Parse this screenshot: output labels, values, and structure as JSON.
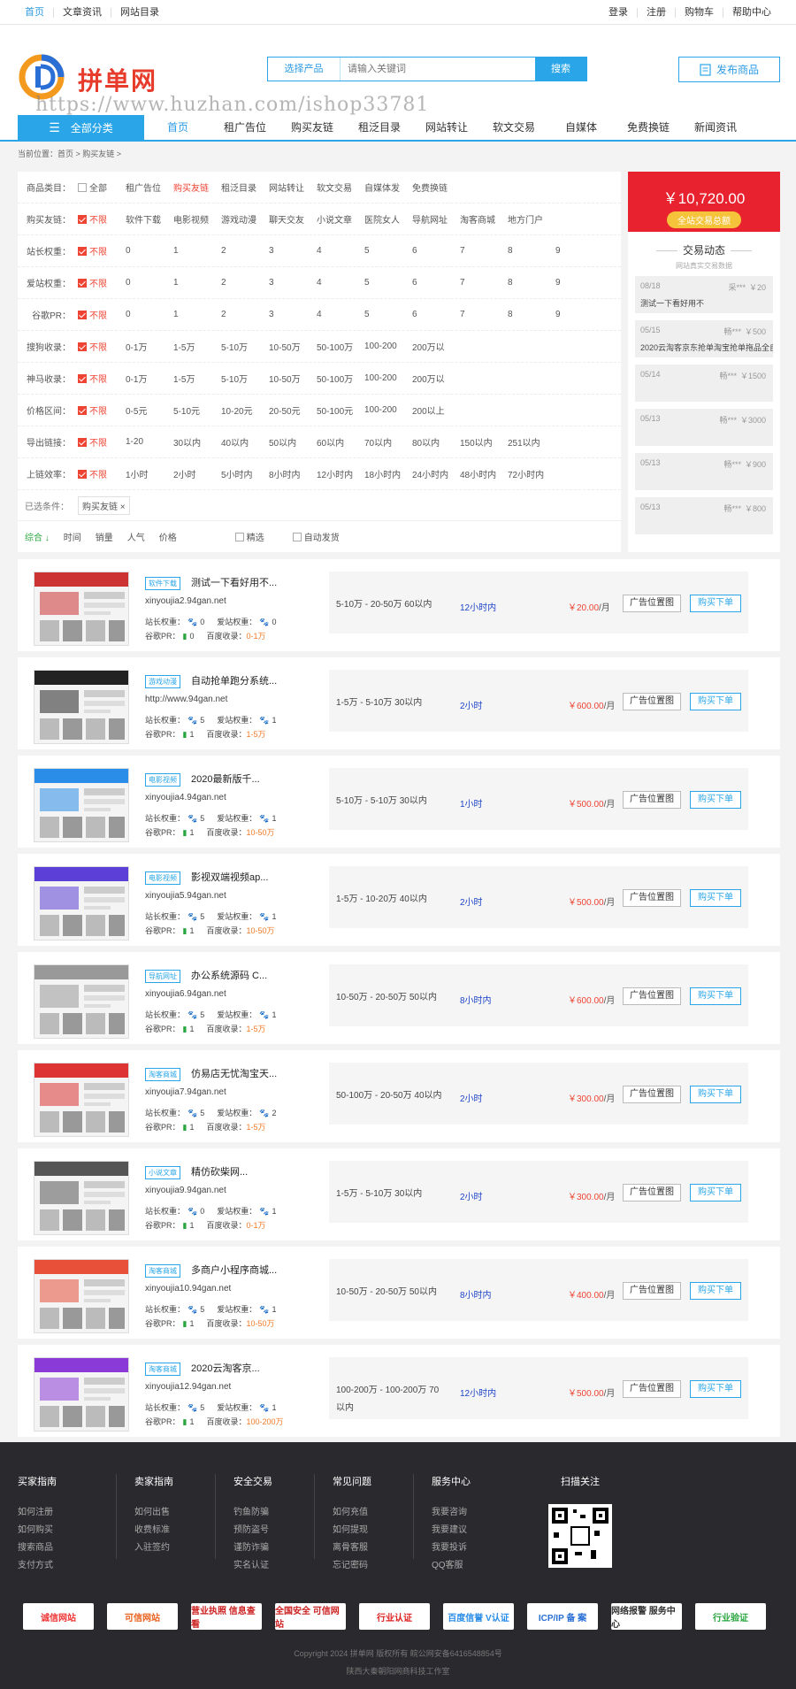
{
  "topbar": {
    "left": [
      "首页",
      "文章资讯",
      "网站目录"
    ],
    "right": [
      "登录",
      "注册",
      "购物车",
      "帮助中心"
    ]
  },
  "header": {
    "brand": "拼单网",
    "watermark": "https://www.huzhan.com/ishop33781",
    "search": {
      "select": "选择产品",
      "placeholder": "请输入关键词",
      "button": "搜索"
    },
    "publish": "发布商品"
  },
  "nav": {
    "all_category": "全部分类",
    "items": [
      "首页",
      "租广告位",
      "购买友链",
      "租泛目录",
      "网站转让",
      "软文交易",
      "自媒体",
      "免费换链",
      "新闻资讯"
    ]
  },
  "breadcrumb": "当前位置：首页 > 购买友链 >",
  "filters": {
    "rows": [
      {
        "label": "商品类目：",
        "options": [
          "全部",
          "租广告位",
          "购买友链",
          "租泛目录",
          "网站转让",
          "软文交易",
          "自媒体发",
          "免费换链"
        ]
      },
      {
        "label": "购买友链：",
        "options": [
          "不限",
          "软件下载",
          "电影视频",
          "游戏动漫",
          "聊天交友",
          "小说文章",
          "医院女人",
          "导航网址",
          "淘客商城",
          "地方门户"
        ]
      },
      {
        "label": "站长权重：",
        "options": [
          "不限",
          "0",
          "1",
          "2",
          "3",
          "4",
          "5",
          "6",
          "7",
          "8",
          "9"
        ]
      },
      {
        "label": "爱站权重：",
        "options": [
          "不限",
          "0",
          "1",
          "2",
          "3",
          "4",
          "5",
          "6",
          "7",
          "8",
          "9"
        ]
      },
      {
        "label": "谷歌PR：",
        "options": [
          "不限",
          "0",
          "1",
          "2",
          "3",
          "4",
          "5",
          "6",
          "7",
          "8",
          "9"
        ]
      },
      {
        "label": "搜狗收录：",
        "options": [
          "不限",
          "0-1万",
          "1-5万",
          "5-10万",
          "10-50万",
          "50-100万",
          "100-200",
          "200万以"
        ]
      },
      {
        "label": "神马收录：",
        "options": [
          "不限",
          "0-1万",
          "1-5万",
          "5-10万",
          "10-50万",
          "50-100万",
          "100-200",
          "200万以"
        ]
      },
      {
        "label": "价格区间：",
        "options": [
          "不限",
          "0-5元",
          "5-10元",
          "10-20元",
          "20-50元",
          "50-100元",
          "100-200",
          "200以上"
        ]
      },
      {
        "label": "导出链接：",
        "options": [
          "不限",
          "1-20",
          "30以内",
          "40以内",
          "50以内",
          "60以内",
          "70以内",
          "80以内",
          "150以内",
          "251以内"
        ]
      },
      {
        "label": "上链效率：",
        "options": [
          "不限",
          "1小时",
          "2小时",
          "5小时内",
          "8小时内",
          "12小时内",
          "18小时内",
          "24小时内",
          "48小时内",
          "72小时内"
        ]
      }
    ],
    "chosen_label": "已选条件：",
    "chosen_tag": "购买友链 ×",
    "sort": [
      "综合 ↓",
      "时间",
      "销量",
      "人气",
      "价格"
    ],
    "checks": [
      "精选",
      "自动发货"
    ]
  },
  "trade": {
    "amount": "￥10,720.00",
    "caption": "全站交易总额",
    "title": "交易动态",
    "subtitle": "网站真实交易数据",
    "items": [
      {
        "date": "08/18",
        "user": "采***",
        "price": "￥20",
        "content": "测试一下看好用不"
      },
      {
        "date": "05/15",
        "user": "畅***",
        "price": "￥500",
        "content": "2020云淘客京东抢单淘宝抢单拖品全自"
      },
      {
        "date": "05/14",
        "user": "畅***",
        "price": "￥1500",
        "content": ""
      },
      {
        "date": "05/13",
        "user": "畅***",
        "price": "￥3000",
        "content": ""
      },
      {
        "date": "05/13",
        "user": "畅***",
        "price": "￥900",
        "content": ""
      },
      {
        "date": "05/13",
        "user": "畅***",
        "price": "￥800",
        "content": ""
      }
    ]
  },
  "listings": [
    {
      "cat": "软件下载",
      "title": "测试一下看好用不...",
      "url": "xinyoujia2.94gan.net",
      "zz": "0",
      "az": "0",
      "pr": "0",
      "bd": "0-1万",
      "traffic": "5-10万 - 20-50万 60以内",
      "hours": "12小时内",
      "price": "￥20.00",
      "unit": "/月",
      "b1": "广告位置图",
      "b2": "购买下单",
      "theme": "#c33"
    },
    {
      "cat": "游戏动漫",
      "title": "自动抢单跑分系统...",
      "url": "http://www.94gan.net",
      "zz": "5",
      "az": "1",
      "pr": "1",
      "bd": "1-5万",
      "traffic": "1-5万 - 5-10万 30以内",
      "hours": "2小时",
      "price": "￥600.00",
      "unit": "/月",
      "b1": "广告位置图",
      "b2": "购买下单",
      "theme": "#222"
    },
    {
      "cat": "电影视频",
      "title": "2020最新版千...",
      "url": "xinyoujia4.94gan.net",
      "zz": "5",
      "az": "1",
      "pr": "1",
      "bd": "10-50万",
      "traffic": "5-10万 - 5-10万 30以内",
      "hours": "1小时",
      "price": "￥500.00",
      "unit": "/月",
      "b1": "广告位置图",
      "b2": "购买下单",
      "theme": "#2a8de8"
    },
    {
      "cat": "电影视频",
      "title": "影视双端视频ap...",
      "url": "xinyoujia5.94gan.net",
      "zz": "5",
      "az": "1",
      "pr": "1",
      "bd": "10-50万",
      "traffic": "1-5万 - 10-20万 40以内",
      "hours": "2小时",
      "price": "￥500.00",
      "unit": "/月",
      "b1": "广告位置图",
      "b2": "购买下单",
      "theme": "#5b3fd6"
    },
    {
      "cat": "导航网址",
      "title": "办公系统源码 C...",
      "url": "xinyoujia6.94gan.net",
      "zz": "5",
      "az": "1",
      "pr": "1",
      "bd": "1-5万",
      "traffic": "10-50万 - 20-50万 50以内",
      "hours": "8小时内",
      "price": "￥600.00",
      "unit": "/月",
      "b1": "广告位置图",
      "b2": "购买下单",
      "theme": "#999"
    },
    {
      "cat": "淘客商城",
      "title": "仿易店无忧淘宝天...",
      "url": "xinyoujia7.94gan.net",
      "zz": "5",
      "az": "2",
      "pr": "1",
      "bd": "1-5万",
      "traffic": "50-100万 - 20-50万 40以内",
      "hours": "2小时",
      "price": "￥300.00",
      "unit": "/月",
      "b1": "广告位置图",
      "b2": "购买下单",
      "theme": "#d33"
    },
    {
      "cat": "小说文章",
      "title": "精仿砍柴网...",
      "url": "xinyoujia9.94gan.net",
      "zz": "0",
      "az": "1",
      "pr": "1",
      "bd": "0-1万",
      "traffic": "1-5万 - 5-10万 30以内",
      "hours": "2小时",
      "price": "￥300.00",
      "unit": "/月",
      "b1": "广告位置图",
      "b2": "购买下单",
      "theme": "#555"
    },
    {
      "cat": "淘客商城",
      "title": "多商户小程序商城...",
      "url": "xinyoujia10.94gan.net",
      "zz": "5",
      "az": "1",
      "pr": "1",
      "bd": "10-50万",
      "traffic": "10-50万 - 20-50万 50以内",
      "hours": "8小时内",
      "price": "￥400.00",
      "unit": "/月",
      "b1": "广告位置图",
      "b2": "购买下单",
      "theme": "#e8503a"
    },
    {
      "cat": "淘客商城",
      "title": "2020云淘客京...",
      "url": "xinyoujia12.94gan.net",
      "zz": "5",
      "az": "1",
      "pr": "1",
      "bd": "100-200万",
      "traffic": "100-200万 - 100-200万 70以内",
      "hours": "12小时内",
      "price": "￥500.00",
      "unit": "/月",
      "b1": "广告位置图",
      "b2": "购买下单",
      "theme": "#8a3ad6"
    }
  ],
  "listing_labels": {
    "zz": "站长权重：",
    "az": "爱站权重：",
    "pr": "谷歌PR：",
    "bd": "百度收录："
  },
  "footer": {
    "cols": [
      {
        "title": "买家指南",
        "links": [
          "如何注册",
          "如何购买",
          "搜索商品",
          "支付方式"
        ]
      },
      {
        "title": "卖家指南",
        "links": [
          "如何出售",
          "收费标准",
          "入驻签约"
        ]
      },
      {
        "title": "安全交易",
        "links": [
          "钓鱼防骗",
          "预防盗号",
          "谨防诈骗",
          "实名认证"
        ]
      },
      {
        "title": "常见问题",
        "links": [
          "如何充值",
          "如何提现",
          "离骨客服",
          "忘记密码"
        ]
      },
      {
        "title": "服务中心",
        "links": [
          "我要咨询",
          "我要建议",
          "我要投诉",
          "QQ客服"
        ]
      }
    ],
    "qr_title": "扫描关注",
    "badges": [
      "诚信网站",
      "可信网站",
      "营业执照 信息查看",
      "全国安全 可信网站",
      "行业认证",
      "百度信誉 V认证",
      "ICP/IP 备 案",
      "网络报警 服务中心",
      "行业验证"
    ],
    "copyright": "Copyright 2024 拼单网 版权所有 皖公网安备6416548854号",
    "company": "陕西大秦朝阳网商科技工作室"
  },
  "colors": {
    "accent": "#2aa6e8",
    "red": "#e8222e",
    "footer_bg": "#2a2a2e"
  }
}
